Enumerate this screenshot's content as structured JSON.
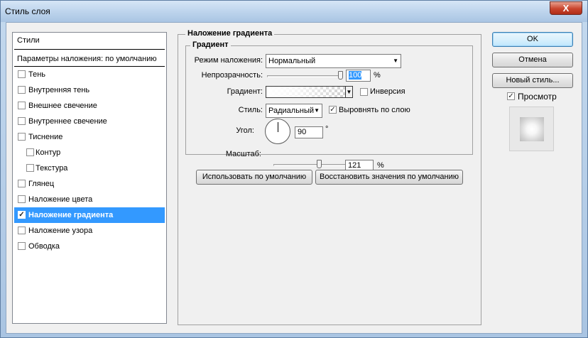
{
  "window": {
    "title": "Стиль слоя",
    "close": "X"
  },
  "styles_panel": {
    "header": "Стили",
    "blending": "Параметры наложения: по умолчанию",
    "items": [
      {
        "label": "Тень",
        "checked": false,
        "sub": false,
        "selected": false
      },
      {
        "label": "Внутренняя тень",
        "checked": false,
        "sub": false,
        "selected": false
      },
      {
        "label": "Внешнее свечение",
        "checked": false,
        "sub": false,
        "selected": false
      },
      {
        "label": "Внутреннее свечение",
        "checked": false,
        "sub": false,
        "selected": false
      },
      {
        "label": "Тиснение",
        "checked": false,
        "sub": false,
        "selected": false
      },
      {
        "label": "Контур",
        "checked": false,
        "sub": true,
        "selected": false
      },
      {
        "label": "Текстура",
        "checked": false,
        "sub": true,
        "selected": false
      },
      {
        "label": "Глянец",
        "checked": false,
        "sub": false,
        "selected": false
      },
      {
        "label": "Наложение цвета",
        "checked": false,
        "sub": false,
        "selected": false
      },
      {
        "label": "Наложение градиента",
        "checked": true,
        "sub": false,
        "selected": true
      },
      {
        "label": "Наложение узора",
        "checked": false,
        "sub": false,
        "selected": false
      },
      {
        "label": "Обводка",
        "checked": false,
        "sub": false,
        "selected": false
      }
    ],
    "check_mark": "✓"
  },
  "gradient_overlay": {
    "section_title": "Наложение градиента",
    "group_title": "Градиент",
    "blend_mode_label": "Режим наложения:",
    "blend_mode_value": "Нормальный",
    "opacity_label": "Непрозрачность:",
    "opacity_value": "100",
    "opacity_fraction": 1.0,
    "percent": "%",
    "gradient_label": "Градиент:",
    "reverse_label": "Инверсия",
    "reverse_checked": false,
    "style_label": "Стиль:",
    "style_value": "Радиальный",
    "align_label": "Выровнять по слою",
    "align_checked": true,
    "angle_label": "Угол:",
    "angle_value": "90",
    "degree": "°",
    "scale_label": "Масштаб:",
    "scale_value": "121",
    "scale_fraction": 0.55,
    "make_default": "Использовать по умолчанию",
    "reset_default": "Восстановить значения по умолчанию",
    "dropdown_arrow": "▼"
  },
  "right_panel": {
    "ok": "OK",
    "cancel": "Отмена",
    "new_style": "Новый стиль...",
    "preview_label": "Просмотр",
    "preview_checked": true
  },
  "colors": {
    "selection": "#3399ff",
    "dialog_bg": "#f0f0f0"
  }
}
